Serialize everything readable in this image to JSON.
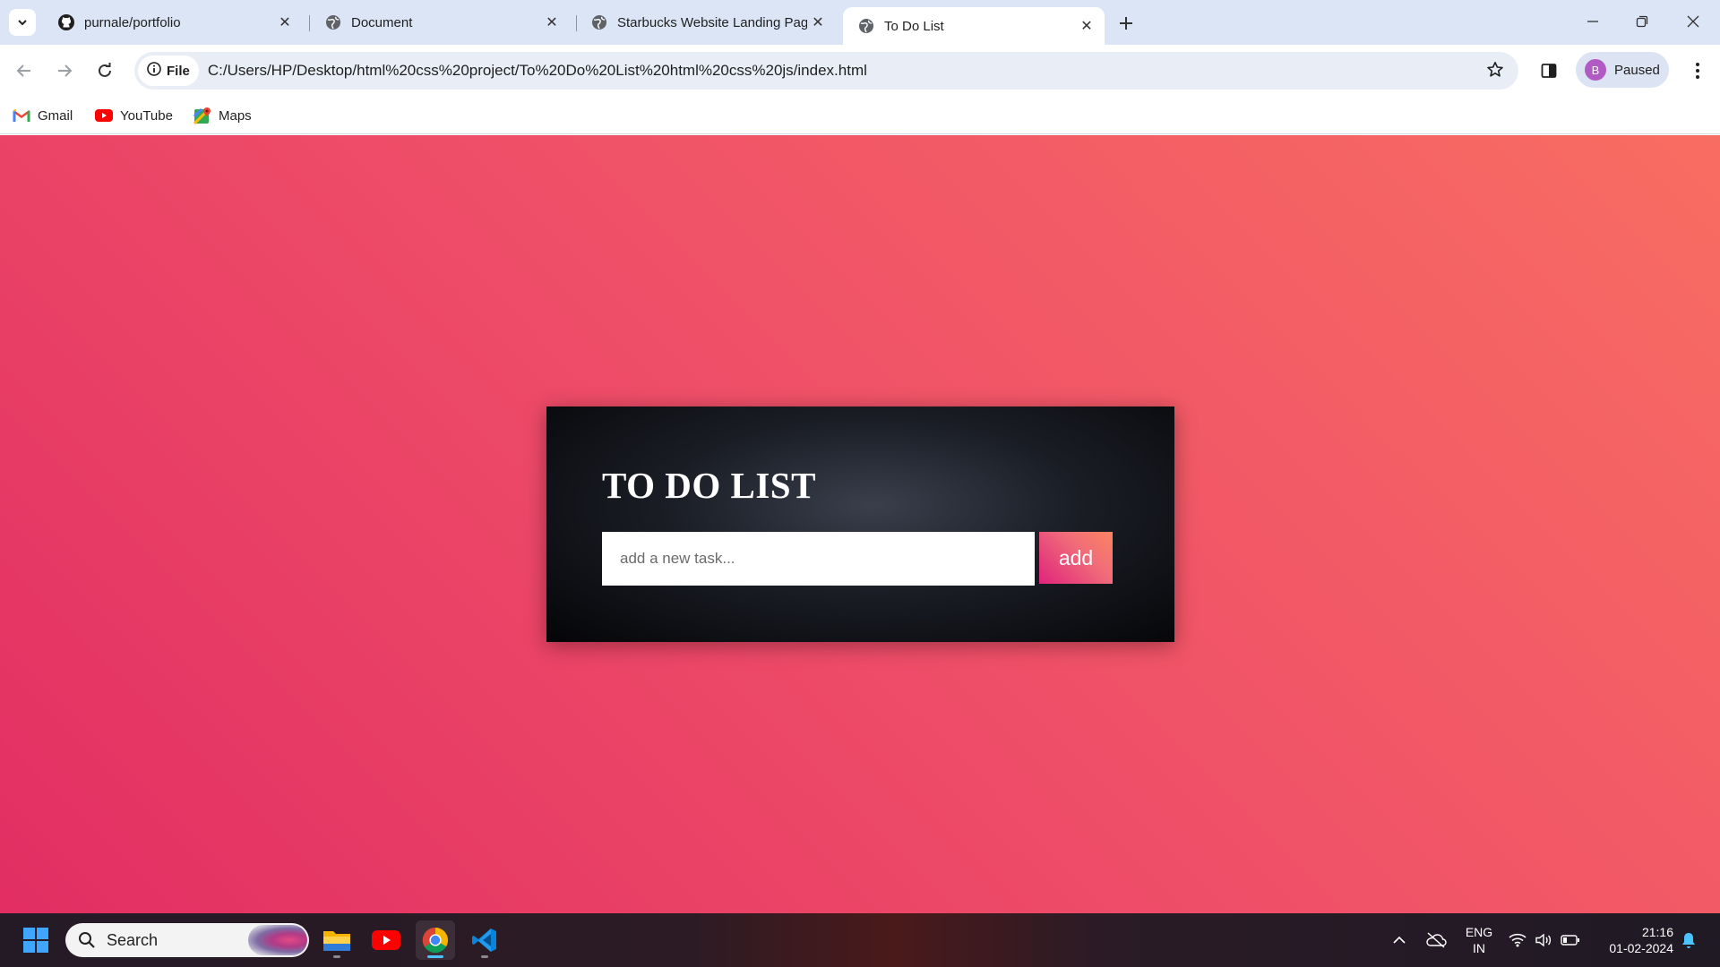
{
  "browser": {
    "tabs": [
      {
        "title": "purnale/portfolio",
        "icon": "github-icon",
        "active": false
      },
      {
        "title": "Document",
        "icon": "globe-icon",
        "active": false
      },
      {
        "title": "Starbucks Website Landing Pag",
        "icon": "globe-icon",
        "active": false
      },
      {
        "title": "To Do List",
        "icon": "globe-icon",
        "active": true
      }
    ],
    "address": {
      "chip_label": "File",
      "url": "C:/Users/HP/Desktop/html%20css%20project/To%20Do%20List%20html%20css%20js/index.html"
    },
    "profile": {
      "initial": "B",
      "status": "Paused",
      "color": "#b15ac4"
    },
    "bookmarks": [
      {
        "label": "Gmail",
        "icon": "gmail-icon"
      },
      {
        "label": "YouTube",
        "icon": "youtube-icon"
      },
      {
        "label": "Maps",
        "icon": "maps-icon"
      }
    ]
  },
  "page": {
    "heading": "TO DO LIST",
    "input_placeholder": "add a new task...",
    "input_value": "",
    "add_label": "add",
    "colors": {
      "bg_gradient_start": "#e22e63",
      "bg_gradient_end": "#f86d62",
      "card_bg": "#1a1d25",
      "button_gradient_start": "#e0247c",
      "button_gradient_end": "#fb8461"
    }
  },
  "taskbar": {
    "search_label": "Search",
    "apps": [
      "file-explorer-icon",
      "youtube-icon",
      "chrome-icon",
      "vscode-icon"
    ],
    "language": {
      "line1": "ENG",
      "line2": "IN"
    },
    "time": "21:16",
    "date": "01-02-2024"
  }
}
